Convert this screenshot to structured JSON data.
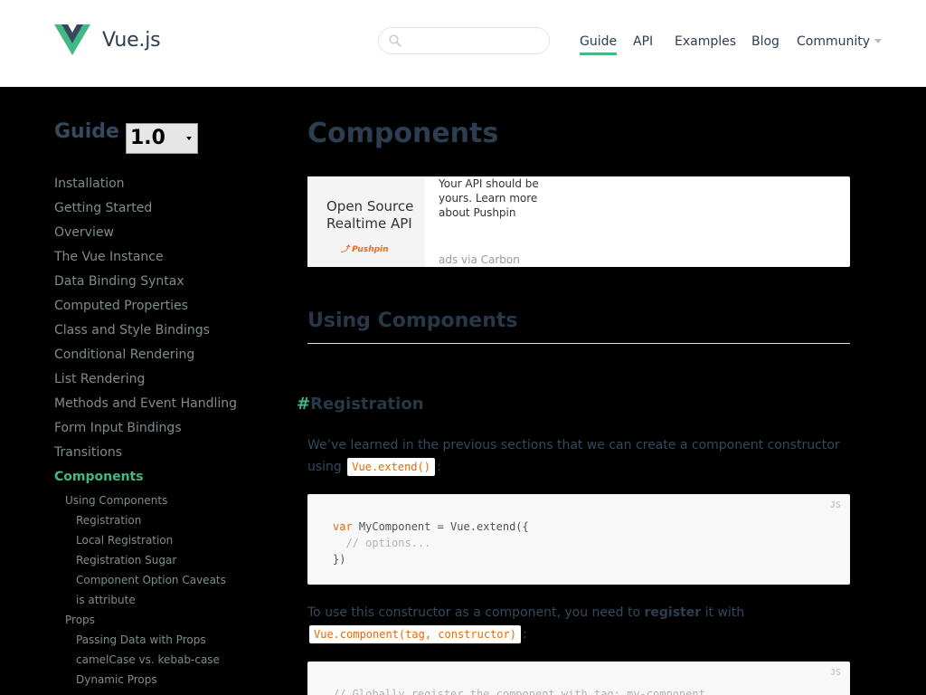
{
  "header": {
    "brand": "Vue.js",
    "search": {
      "value": "",
      "placeholder": ""
    },
    "nav": [
      {
        "label": "Guide",
        "active": true
      },
      {
        "label": "API"
      },
      {
        "label": "Examples"
      },
      {
        "label": "Blog"
      },
      {
        "label": "Community",
        "dropdown": true
      }
    ]
  },
  "sidebar": {
    "title": "Guide",
    "version": "1.0",
    "items": [
      "Installation",
      "Getting Started",
      "Overview",
      "The Vue Instance",
      "Data Binding Syntax",
      "Computed Properties",
      "Class and Style Bindings",
      "Conditional Rendering",
      "List Rendering",
      "Methods and Event Handling",
      "Form Input Bindings",
      "Transitions",
      "Components"
    ],
    "active_item": "Components",
    "subitems": [
      {
        "label": "Using Components",
        "level": 1
      },
      {
        "label": "Registration",
        "level": 2
      },
      {
        "label": "Local Registration",
        "level": 2
      },
      {
        "label": "Registration Sugar",
        "level": 2
      },
      {
        "label": "Component Option Caveats",
        "level": 2
      },
      {
        "label": "is attribute",
        "level": 2
      },
      {
        "label": "Props",
        "level": 1
      },
      {
        "label": "Passing Data with Props",
        "level": 2
      },
      {
        "label": "camelCase vs. kebab-case",
        "level": 2
      },
      {
        "label": "Dynamic Props",
        "level": 2
      }
    ]
  },
  "main": {
    "title": "Components",
    "ad": {
      "image_text_line1": "Open Source",
      "image_text_line2": "Realtime API",
      "image_brand": "Pushpin",
      "text": "Your API should be yours. Learn more about Pushpin",
      "via": "ads via Carbon"
    },
    "section_heading": "Using Components",
    "subsection_hash": "#",
    "subsection_heading": "Registration",
    "p1_text": "We’ve learned in the previous sections that we can create a component constructor using",
    "p1_code": "Vue.extend()",
    "p1_end": ":",
    "code1": {
      "lang": "JS",
      "line1_kw": "var",
      "line1_rest": " MyComponent = Vue.extend({",
      "line2": "  // options...",
      "line3": "})"
    },
    "p2_text": "To use this constructor as a component, you need to",
    "p2_bold": "register",
    "p2_text2": "it with",
    "p2_code": "Vue.component(tag, constructor)",
    "p2_end": ":",
    "code2": {
      "lang": "JS",
      "line1": "// Globally register the component with tag: my-component"
    }
  },
  "colors": {
    "accent": "#42b983",
    "heading": "#2c3e50",
    "inline_code": "#e96900",
    "background": "#000000"
  }
}
